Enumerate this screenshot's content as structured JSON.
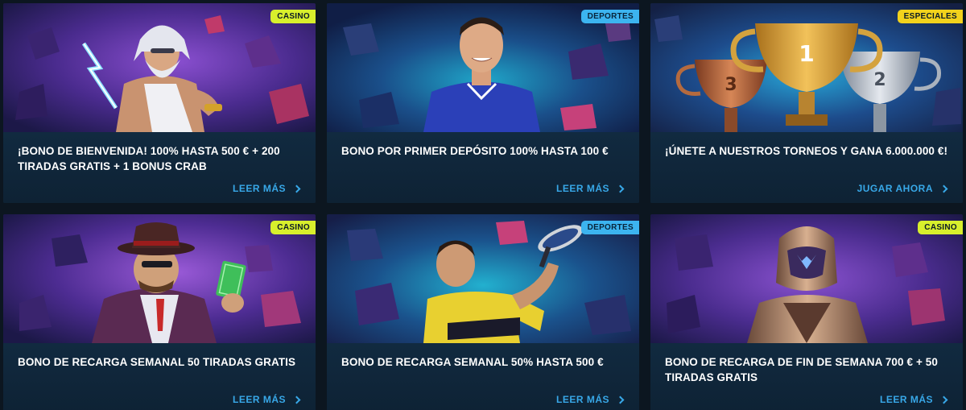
{
  "cards": [
    {
      "badge": "CASINO",
      "badge_type": "casino",
      "illustration": "zeus-god-icon",
      "title": "¡BONO DE BIENVENIDA! 100% HASTA 500 € + 200 TIRADAS GRATIS + 1 BONUS CRAB",
      "cta": "LEER MÁS"
    },
    {
      "badge": "DEPORTES",
      "badge_type": "deportes",
      "illustration": "football-player-icon",
      "title": "BONO POR PRIMER DEPÓSITO 100% HASTA 100 €",
      "cta": "LEER MÁS"
    },
    {
      "badge": "ESPECIALES",
      "badge_type": "especiales",
      "illustration": "trophies-icon",
      "title": "¡ÚNETE A NUESTROS TORNEOS Y GANA 6.000.000 €!",
      "cta": "JUGAR AHORA"
    },
    {
      "badge": "CASINO",
      "badge_type": "casino",
      "illustration": "gangster-character-icon",
      "title": "BONO DE RECARGA SEMANAL 50 TIRADAS GRATIS",
      "cta": "LEER MÁS"
    },
    {
      "badge": "DEPORTES",
      "badge_type": "deportes",
      "illustration": "tennis-player-icon",
      "title": "BONO DE RECARGA SEMANAL 50% HASTA 500 €",
      "cta": "LEER MÁS"
    },
    {
      "badge": "CASINO",
      "badge_type": "casino",
      "illustration": "armored-warrior-icon",
      "title": "BONO DE RECARGA DE FIN DE SEMANA 700 € + 50 TIRADAS GRATIS",
      "cta": "LEER MÁS"
    }
  ],
  "trophy_numbers": [
    "1",
    "2",
    "3"
  ],
  "colors": {
    "page_bg": "#0c1620",
    "card_bg": "#10263a",
    "cta": "#38a8e8",
    "badge_casino": "#d8ef2c",
    "badge_deportes": "#3cb4f0",
    "badge_especiales": "#f2d21c"
  }
}
